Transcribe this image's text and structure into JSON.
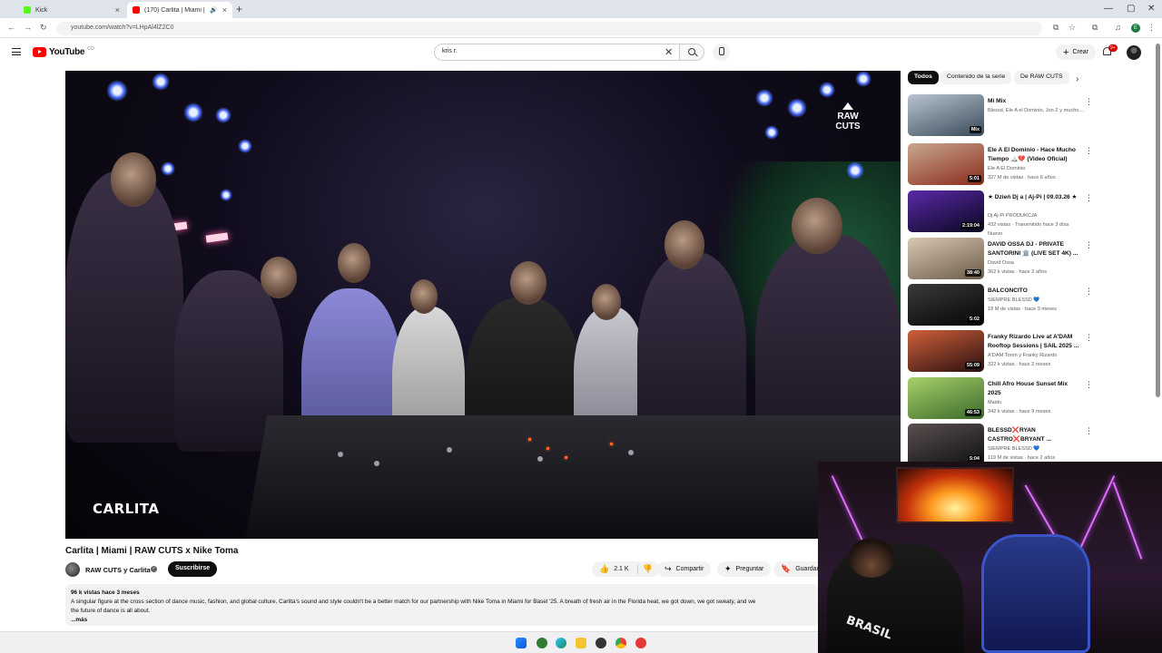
{
  "browser": {
    "tabs": [
      {
        "label": "Kick",
        "active": false
      },
      {
        "label": "(170) Carlita | Miami | RAW",
        "active": true
      }
    ],
    "url": "youtube.com/watch?v=LHpAl4lZ2C0"
  },
  "header": {
    "logo_text": "YouTube",
    "logo_country": "CO",
    "search_value": "kris r.",
    "create_label": "Crear",
    "notification_count": "9+"
  },
  "video": {
    "title": "Carlita | Miami | RAW CUTS x Nike Toma",
    "overlay_artist": "CARLITA",
    "overlay_logo": "RAW CUTS",
    "channel_name": "RAW CUTS y Carlita",
    "subscribe_label": "Suscribirse",
    "actions": {
      "likes": "2.1 K",
      "share": "Compartir",
      "ask": "Preguntar",
      "save": "Guardar"
    },
    "description": {
      "meta": "96 k vistas  hace 3 meses",
      "text": "A singular figure at the cross section of dance music, fashion, and global culture, Carlita's sound and style couldn't be a better match for our partnership with Nike Toma in Miami for Basel '25. A breath of fresh air in the Florida heat, we got down, we got sweaty, and we",
      "text_line2": "the future of dance is all about.",
      "more": "...más"
    }
  },
  "sidebar": {
    "chips": [
      "Todos",
      "Contenido de la serie",
      "De RAW CUTS"
    ],
    "recommendations": [
      {
        "title": "Mi Mix",
        "channel": "Blessd, Ele A el Dominio, Jon Z y mucho...",
        "stats": "",
        "badge": "",
        "duration": "Mix",
        "thumb_colors": [
          "#b8c4d0",
          "#3a4a5a"
        ]
      },
      {
        "title": "Ele A El Dominio - Hace Mucho Tiempo 🏔️💔 (Video Oficial)",
        "channel": "Ele A El Dominio",
        "stats": "327 M de vistas · hace 6 años",
        "badge": "",
        "duration": "5:01",
        "thumb_colors": [
          "#c8a890",
          "#8a2a1a"
        ]
      },
      {
        "title": "★ Dzień Dj a | Aj-Pi | 09.03.26 ★",
        "channel": "Dj Aj-Pi PRODUKCJA",
        "stats": "432 vistas · Transmitido hace 3 días",
        "badge": "Nuevo",
        "duration": "2:19:04",
        "thumb_colors": [
          "#5a2aa8",
          "#0a0620"
        ]
      },
      {
        "title": "DAVID OSSA DJ - PRIVATE SANTORINI 🏛️ (LIVE SET 4K) ...",
        "channel": "David Ossa",
        "stats": "362 k vistas · hace 2 años",
        "badge": "",
        "duration": "38:40",
        "thumb_colors": [
          "#d8c8b4",
          "#6a5a48"
        ]
      },
      {
        "title": "BALCONCITO",
        "channel": "SIEMPRE BLESSD 💙",
        "stats": "18 M de vistas · hace 9 meses",
        "badge": "",
        "duration": "5:02",
        "thumb_colors": [
          "#3a3a3a",
          "#050505"
        ]
      },
      {
        "title": "Franky Rizardo Live at A'DAM Rooftop Sessions | SAIL 2025 ...",
        "channel": "A'DAM Toren y Franky Rizardo",
        "stats": "322 k vistas · hace 2 meses",
        "badge": "",
        "duration": "55:09",
        "thumb_colors": [
          "#d0603a",
          "#2a1010"
        ]
      },
      {
        "title": "Chill Afro House Sunset Mix 2025",
        "channel": "Maido",
        "stats": "342 k vistas · hace 9 meses",
        "badge": "",
        "duration": "46:53",
        "thumb_colors": [
          "#a8d06a",
          "#3a6a2a"
        ]
      },
      {
        "title": "BLESSD❌RYAN CASTRO❌BRYANT ...",
        "channel": "SIEMPRE BLESSD 💙",
        "stats": "119 M de vistas · hace 2 años",
        "badge": "",
        "duration": "5:04",
        "thumb_colors": [
          "#5a5050",
          "#101010"
        ]
      }
    ]
  },
  "webcam": {
    "shirt_text": "BRASIL"
  }
}
